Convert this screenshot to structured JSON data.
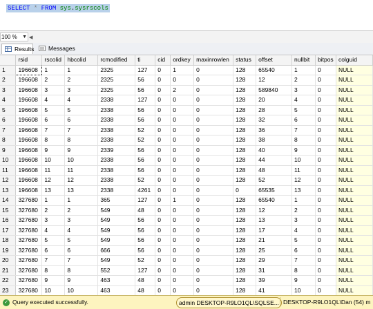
{
  "editor": {
    "kw_select": "SELECT",
    "star": "*",
    "kw_from": "FROM",
    "schema": "sys",
    "dot": ".",
    "object": "sysrscols"
  },
  "zoom": {
    "value": "100 %"
  },
  "tabs": [
    {
      "label": "Results"
    },
    {
      "label": "Messages"
    }
  ],
  "grid": {
    "columns": [
      "rsid",
      "rscolid",
      "hbcolid",
      "rcmodified",
      "ti",
      "cid",
      "ordkey",
      "maxinrowlen",
      "status",
      "offset",
      "nullbit",
      "bitpos",
      "colguid"
    ],
    "rows": [
      [
        "1",
        "196608",
        "1",
        "1",
        "2325",
        "127",
        "0",
        "1",
        "0",
        "128",
        "65540",
        "1",
        "0",
        "NULL"
      ],
      [
        "2",
        "196608",
        "2",
        "2",
        "2325",
        "56",
        "0",
        "0",
        "0",
        "128",
        "12",
        "2",
        "0",
        "NULL"
      ],
      [
        "3",
        "196608",
        "3",
        "3",
        "2325",
        "56",
        "0",
        "2",
        "0",
        "128",
        "589840",
        "3",
        "0",
        "NULL"
      ],
      [
        "4",
        "196608",
        "4",
        "4",
        "2338",
        "127",
        "0",
        "0",
        "0",
        "128",
        "20",
        "4",
        "0",
        "NULL"
      ],
      [
        "5",
        "196608",
        "5",
        "5",
        "2338",
        "56",
        "0",
        "0",
        "0",
        "128",
        "28",
        "5",
        "0",
        "NULL"
      ],
      [
        "6",
        "196608",
        "6",
        "6",
        "2338",
        "56",
        "0",
        "0",
        "0",
        "128",
        "32",
        "6",
        "0",
        "NULL"
      ],
      [
        "7",
        "196608",
        "7",
        "7",
        "2338",
        "52",
        "0",
        "0",
        "0",
        "128",
        "36",
        "7",
        "0",
        "NULL"
      ],
      [
        "8",
        "196608",
        "8",
        "8",
        "2338",
        "52",
        "0",
        "0",
        "0",
        "128",
        "38",
        "8",
        "0",
        "NULL"
      ],
      [
        "9",
        "196608",
        "9",
        "9",
        "2339",
        "56",
        "0",
        "0",
        "0",
        "128",
        "40",
        "9",
        "0",
        "NULL"
      ],
      [
        "10",
        "196608",
        "10",
        "10",
        "2338",
        "56",
        "0",
        "0",
        "0",
        "128",
        "44",
        "10",
        "0",
        "NULL"
      ],
      [
        "11",
        "196608",
        "11",
        "11",
        "2338",
        "56",
        "0",
        "0",
        "0",
        "128",
        "48",
        "11",
        "0",
        "NULL"
      ],
      [
        "12",
        "196608",
        "12",
        "12",
        "2338",
        "52",
        "0",
        "0",
        "0",
        "128",
        "52",
        "12",
        "0",
        "NULL"
      ],
      [
        "13",
        "196608",
        "13",
        "13",
        "2338",
        "4261",
        "0",
        "0",
        "0",
        "0",
        "65535",
        "13",
        "0",
        "NULL"
      ],
      [
        "14",
        "327680",
        "1",
        "1",
        "365",
        "127",
        "0",
        "1",
        "0",
        "128",
        "65540",
        "1",
        "0",
        "NULL"
      ],
      [
        "15",
        "327680",
        "2",
        "2",
        "549",
        "48",
        "0",
        "0",
        "0",
        "128",
        "12",
        "2",
        "0",
        "NULL"
      ],
      [
        "16",
        "327680",
        "3",
        "3",
        "549",
        "56",
        "0",
        "0",
        "0",
        "128",
        "13",
        "3",
        "0",
        "NULL"
      ],
      [
        "17",
        "327680",
        "4",
        "4",
        "549",
        "56",
        "0",
        "0",
        "0",
        "128",
        "17",
        "4",
        "0",
        "NULL"
      ],
      [
        "18",
        "327680",
        "5",
        "5",
        "549",
        "56",
        "0",
        "0",
        "0",
        "128",
        "21",
        "5",
        "0",
        "NULL"
      ],
      [
        "19",
        "327680",
        "6",
        "6",
        "666",
        "56",
        "0",
        "0",
        "0",
        "128",
        "25",
        "6",
        "0",
        "NULL"
      ],
      [
        "20",
        "327680",
        "7",
        "7",
        "549",
        "52",
        "0",
        "0",
        "0",
        "128",
        "29",
        "7",
        "0",
        "NULL"
      ],
      [
        "21",
        "327680",
        "8",
        "8",
        "552",
        "127",
        "0",
        "0",
        "0",
        "128",
        "31",
        "8",
        "0",
        "NULL"
      ],
      [
        "22",
        "327680",
        "9",
        "9",
        "463",
        "48",
        "0",
        "0",
        "0",
        "128",
        "39",
        "9",
        "0",
        "NULL"
      ],
      [
        "23",
        "327680",
        "10",
        "10",
        "463",
        "48",
        "0",
        "0",
        "0",
        "128",
        "41",
        "10",
        "0",
        "NULL"
      ],
      [
        "24",
        "327680",
        "11",
        "11",
        "463",
        "52",
        "0",
        "0",
        "0",
        "128",
        "42",
        "11",
        "0",
        "NULL"
      ]
    ]
  },
  "status": {
    "message": "Query executed successfully.",
    "user": "admin",
    "connection": "DESKTOP-R9LO1QL\\SQLSE...",
    "server": "DESKTOP-R9LO1QL\\Dan (54)",
    "extra": "m"
  }
}
